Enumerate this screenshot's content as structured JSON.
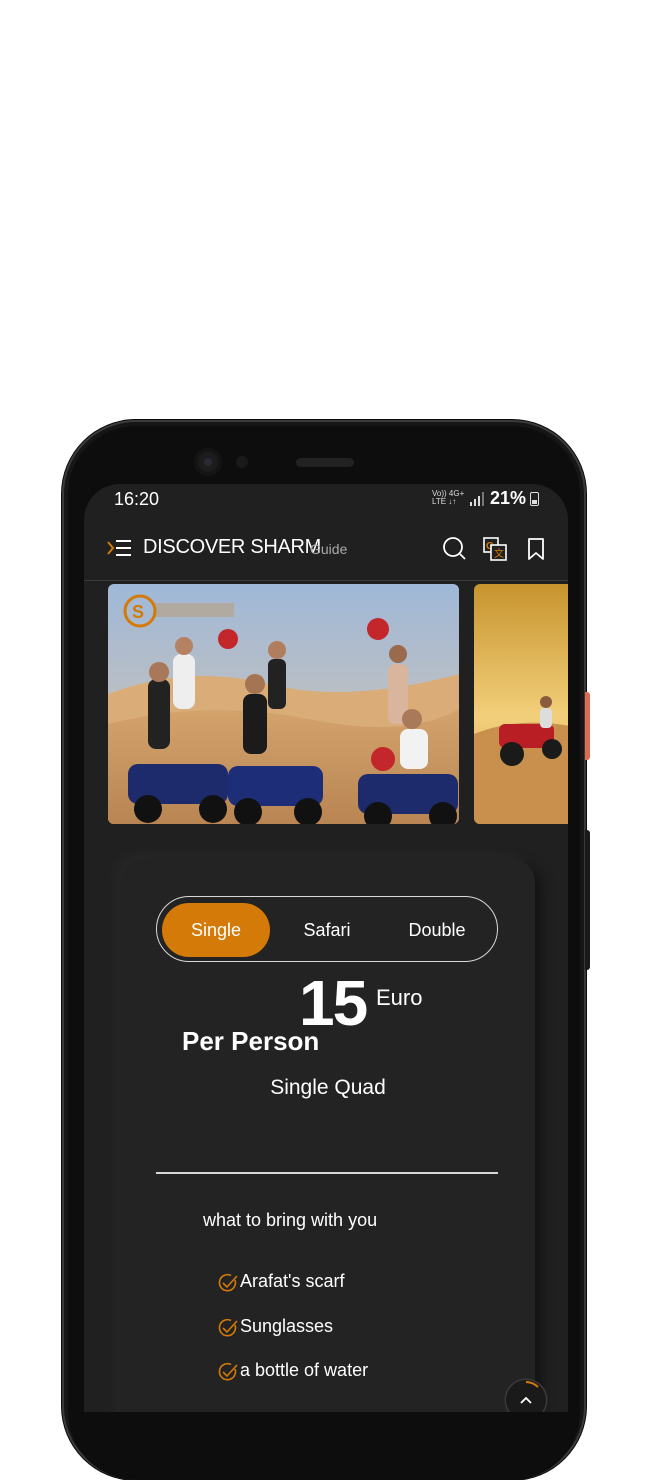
{
  "status_bar": {
    "time": "16:20",
    "network_top": "Vo)) 4G+",
    "network_bottom": "LTE  ↓↑",
    "battery": "21%"
  },
  "app_bar": {
    "title": "DISCOVER SHARM",
    "subtitle": "Guide",
    "icons": [
      "menu-icon",
      "search-icon",
      "translate-icon",
      "bookmark-icon"
    ]
  },
  "carousel": {
    "slides": [
      {
        "caption": "people on quad bikes in desert dunes",
        "logo_text": "DISCOVER SHARM"
      },
      {
        "caption": "quad bike riding at sunset"
      }
    ]
  },
  "tabs": [
    {
      "label": "Single",
      "active": true
    },
    {
      "label": "Safari",
      "active": false
    },
    {
      "label": "Double",
      "active": false
    }
  ],
  "price": {
    "amount": "15",
    "currency": "Euro",
    "per": "Per Person"
  },
  "product_name": "Single Quad",
  "bring": {
    "heading": "what to bring with you",
    "items": [
      "Arafat's scarf",
      "Sunglasses",
      "a bottle of water"
    ]
  },
  "colors": {
    "accent": "#d47a08",
    "background": "#202020",
    "card": "#232323"
  }
}
